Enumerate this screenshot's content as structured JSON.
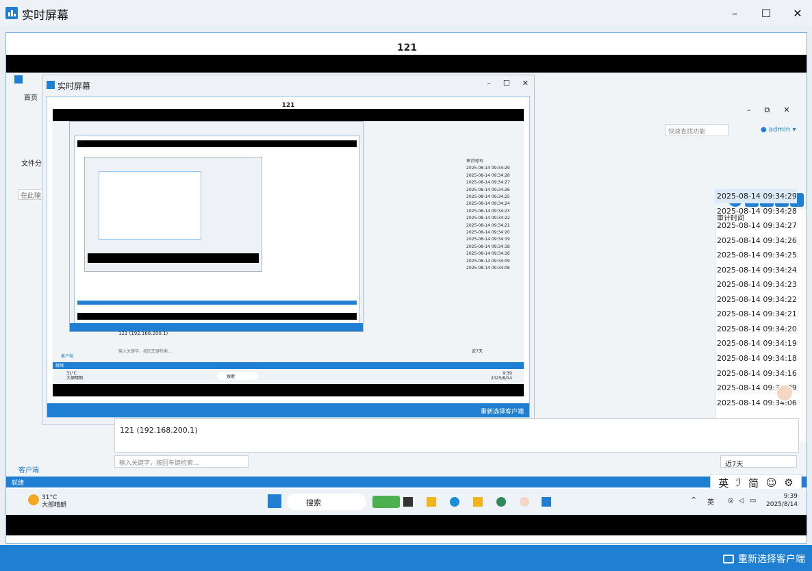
{
  "window": {
    "title": "实时屏幕",
    "minimize": "–",
    "maximize": "☐",
    "close": "✕"
  },
  "remote": {
    "client_name": "121",
    "app": {
      "menu_home": "首页",
      "toolbar_label": "文件分发",
      "search_placeholder": "在此输入",
      "quick_find": "快速查找功能",
      "user": "admin",
      "user_caret": "▾",
      "win_ctrls": [
        "–",
        "⧉",
        "✕"
      ],
      "audit_time_header": "审计时间",
      "audit_times": [
        "2025-08-14 09:34:29",
        "2025-08-14 09:34:28",
        "2025-08-14 09:34:27",
        "2025-08-14 09:34:26",
        "2025-08-14 09:34:25",
        "2025-08-14 09:34:24",
        "2025-08-14 09:34:23",
        "2025-08-14 09:34:22",
        "2025-08-14 09:34:21",
        "2025-08-14 09:34:20",
        "2025-08-14 09:34:19",
        "2025-08-14 09:34:18",
        "2025-08-14 09:34:16",
        "2025-08-14 09:34:09",
        "2025-08-14 09:34:06"
      ],
      "detail_text": "121 (192.168.200.1)",
      "keyword_placeholder": "输入关键字，按回车键检索...",
      "period": "近7天",
      "client_tab": "客户端",
      "status": "就绪"
    },
    "ime": {
      "items": [
        "英",
        "ℐ",
        "简",
        "☺",
        "⚙"
      ]
    },
    "taskbar": {
      "temperature": "31°C",
      "weather": "大部晴朗",
      "search": "搜索",
      "tray_caret": "^",
      "tray_lang": "英",
      "time": "9:39",
      "date": "2025/8/14"
    },
    "nested": {
      "title": "实时屏幕",
      "client_name": "121",
      "reselect": "重新选择客户端",
      "detail_text": "121 (192.168.200.1)",
      "keyword_placeholder": "输入关键字，按回车键检索...",
      "period": "近7天",
      "client_tab": "客户端",
      "status": "就绪",
      "temperature": "31°C",
      "weather": "大部晴朗",
      "search": "搜索",
      "time": "9:39",
      "date": "2025/8/14",
      "audit_time_header": "审计时间",
      "audit_times": [
        "2025-08-14 09:34:29",
        "2025-08-14 09:34:28",
        "2025-08-14 09:34:27",
        "2025-08-14 09:34:26",
        "2025-08-14 09:34:25",
        "2025-08-14 09:34:24",
        "2025-08-14 09:34:23",
        "2025-08-14 09:34:22",
        "2025-08-14 09:34:21",
        "2025-08-14 09:34:20",
        "2025-08-14 09:34:19",
        "2025-08-14 09:34:18",
        "2025-08-14 09:34:16",
        "2025-08-14 09:34:09",
        "2025-08-14 09:34:06"
      ]
    }
  },
  "footer": {
    "reselect_label": "重新选择客户端"
  },
  "colors": {
    "accent": "#1f7fd3",
    "black": "#000000"
  }
}
